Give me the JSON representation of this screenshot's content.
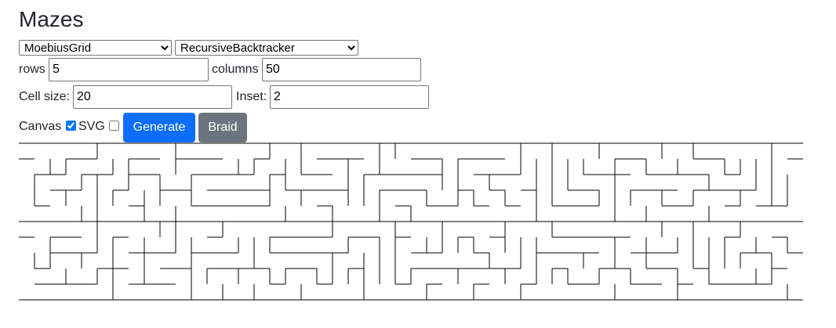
{
  "page": {
    "title": "Mazes"
  },
  "controls": {
    "grid_type": {
      "selected": "MoebiusGrid"
    },
    "algorithm": {
      "selected": "RecursiveBacktracker"
    },
    "rows": {
      "label": "rows",
      "value": "5"
    },
    "columns": {
      "label": "columns",
      "value": "50"
    },
    "cell_size": {
      "label": "Cell size:",
      "value": "20"
    },
    "inset": {
      "label": "Inset:",
      "value": "2"
    },
    "canvas": {
      "label": "Canvas",
      "checked": true
    },
    "svg": {
      "label": "SVG",
      "checked": false
    },
    "generate_label": "Generate",
    "braid_label": "Braid"
  },
  "colors": {
    "primary": "#0d6efd",
    "secondary": "#6c757d",
    "wall": "#000000"
  },
  "maze": {
    "rows": 5,
    "columns": 50,
    "halves": 2
  }
}
